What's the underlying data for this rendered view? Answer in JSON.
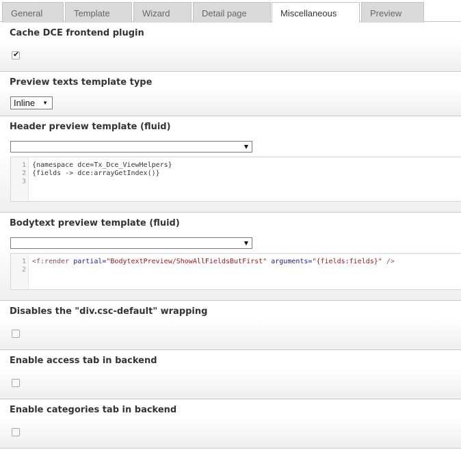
{
  "tabs": [
    {
      "label": "General",
      "active": false
    },
    {
      "label": "Template",
      "active": false
    },
    {
      "label": "Wizard",
      "active": false
    },
    {
      "label": "Detail page",
      "active": false
    },
    {
      "label": "Miscellaneous",
      "active": true
    },
    {
      "label": "Preview",
      "active": false
    }
  ],
  "cache_plugin": {
    "label": "Cache DCE frontend plugin",
    "checked": true
  },
  "preview_type": {
    "label": "Preview texts template type",
    "selected": "Inline"
  },
  "header_template": {
    "label": "Header preview template (fluid)",
    "select_value": "",
    "lines": [
      {
        "num": "1",
        "text": "{namespace dce=Tx_Dce_ViewHelpers}"
      },
      {
        "num": "2",
        "text": "{fields -> dce:arrayGetIndex()}"
      },
      {
        "num": "3",
        "text": ""
      }
    ]
  },
  "bodytext_template": {
    "label": "Bodytext preview template (fluid)",
    "select_value": "",
    "lines": [
      {
        "num": "1",
        "tag_open": "<f:render",
        "attr1": "partial=",
        "val1": "\"BodytextPreview/ShowAllFieldsButFirst\"",
        "attr2": "arguments=",
        "val2": "\"{fields:fields}\"",
        "tag_close": "/>"
      },
      {
        "num": "2",
        "text": ""
      }
    ]
  },
  "disable_wrapping": {
    "label": "Disables the \"div.csc-default\" wrapping",
    "checked": false
  },
  "access_tab": {
    "label": "Enable access tab in backend",
    "checked": false
  },
  "categories_tab": {
    "label": "Enable categories tab in backend",
    "checked": false
  },
  "icons": {
    "select_arrow": "▼",
    "check": "✔"
  }
}
